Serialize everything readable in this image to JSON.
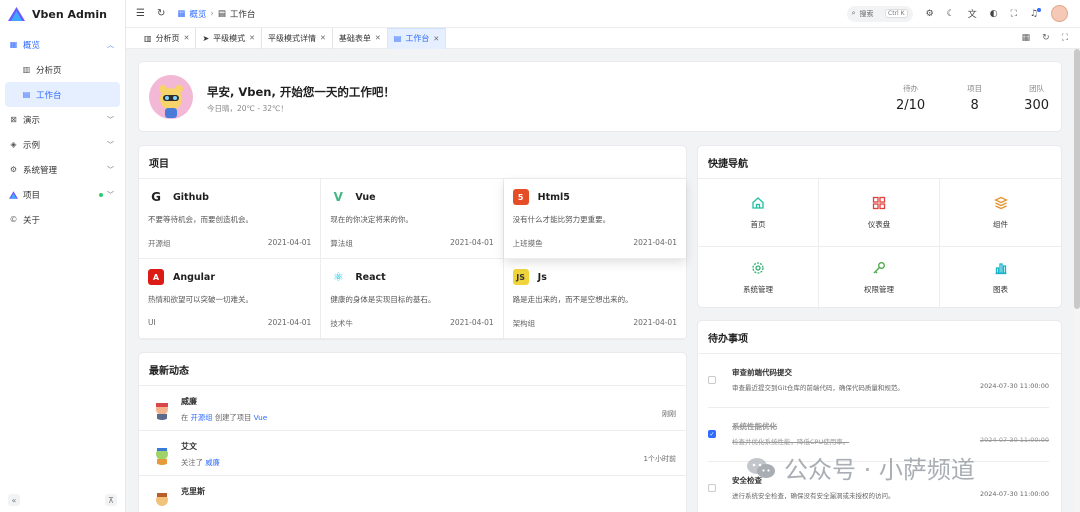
{
  "app": {
    "title": "Vben Admin"
  },
  "sidebar": {
    "items": [
      {
        "label": "概览",
        "icon": "grid-icon"
      },
      {
        "label": "分析页",
        "icon": "chart-icon"
      },
      {
        "label": "工作台",
        "icon": "workspace-icon"
      },
      {
        "label": "演示",
        "icon": "demo-icon"
      },
      {
        "label": "示例",
        "icon": "layers-icon"
      },
      {
        "label": "系统管理",
        "icon": "gear-icon"
      },
      {
        "label": "项目",
        "icon": "vben-icon"
      },
      {
        "label": "关于",
        "icon": "copyright-icon"
      }
    ]
  },
  "header": {
    "breadcrumb": [
      "概览",
      "工作台"
    ],
    "search_placeholder": "搜索",
    "search_shortcut": "Ctrl K"
  },
  "tabs": [
    {
      "label": "分析页"
    },
    {
      "label": "平级模式"
    },
    {
      "label": "平级模式详情"
    },
    {
      "label": "基础表单"
    },
    {
      "label": "工作台"
    }
  ],
  "welcome": {
    "title": "早安, Vben, 开始您一天的工作吧！",
    "subtitle": "今日晴，20℃ - 32℃！",
    "stats": [
      {
        "label": "待办",
        "value": "2/10"
      },
      {
        "label": "项目",
        "value": "8"
      },
      {
        "label": "团队",
        "value": "300"
      }
    ]
  },
  "projects": {
    "title": "项目",
    "items": [
      {
        "name": "Github",
        "desc": "不要等待机会，而要创造机会。",
        "group": "开源组",
        "date": "2021-04-01",
        "logo": "G",
        "color": "#222222"
      },
      {
        "name": "Vue",
        "desc": "现在的你决定将来的你。",
        "group": "算法组",
        "date": "2021-04-01",
        "logo": "V",
        "color": "#41b883"
      },
      {
        "name": "Html5",
        "desc": "没有什么才能比努力更重要。",
        "group": "上班摸鱼",
        "date": "2021-04-01",
        "logo": "5",
        "color": "#e44d26"
      },
      {
        "name": "Angular",
        "desc": "热情和欲望可以突破一切难关。",
        "group": "UI",
        "date": "2021-04-01",
        "logo": "A",
        "color": "#dd1b16"
      },
      {
        "name": "React",
        "desc": "健康的身体是实现目标的基石。",
        "group": "技术牛",
        "date": "2021-04-01",
        "logo": "⚛",
        "color": "#00c2e8"
      },
      {
        "name": "Js",
        "desc": "路是走出来的，而不是空想出来的。",
        "group": "架构组",
        "date": "2021-04-01",
        "logo": "JS",
        "color": "#f0d43c"
      }
    ]
  },
  "quick_nav": {
    "title": "快捷导航",
    "items": [
      {
        "label": "首页",
        "icon": "home-icon",
        "color": "#1fbf9f"
      },
      {
        "label": "仪表盘",
        "icon": "dashboard-icon",
        "color": "#e0413d"
      },
      {
        "label": "组件",
        "icon": "stack-icon",
        "color": "#e8922b"
      },
      {
        "label": "系统管理",
        "icon": "gear-icon",
        "color": "#2fb06f"
      },
      {
        "label": "权限管理",
        "icon": "key-icon",
        "color": "#4aa84a"
      },
      {
        "label": "图表",
        "icon": "bar-chart-icon",
        "color": "#18b3c9"
      }
    ]
  },
  "news": {
    "title": "最新动态",
    "items": [
      {
        "name": "威廉",
        "pre": "在",
        "link1": "开源组",
        "mid": "创建了项目",
        "link2": "Vue",
        "time": "刚刚"
      },
      {
        "name": "艾文",
        "pre": "关注了",
        "link1": "威廉",
        "mid": "",
        "link2": "",
        "time": "1个小时前"
      },
      {
        "name": "克里斯",
        "pre": "",
        "link1": "",
        "mid": "",
        "link2": "",
        "time": ""
      }
    ]
  },
  "todo": {
    "title": "待办事项",
    "items": [
      {
        "title": "审查前端代码提交",
        "desc": "审查最近提交到Git仓库的前端代码，确保代码质量和规范。",
        "date": "2024-07-30 11:00:00",
        "done": false
      },
      {
        "title": "系统性能优化",
        "desc": "检查并优化系统性能，降低CPU使用率。",
        "date": "2024-07-30 11:00:00",
        "done": true
      },
      {
        "title": "安全检查",
        "desc": "进行系统安全检查，确保没有安全漏洞或未授权的访问。",
        "date": "2024-07-30 11:00:00",
        "done": false
      }
    ]
  },
  "watermark": {
    "text": "公众号 · 小萨频道"
  }
}
